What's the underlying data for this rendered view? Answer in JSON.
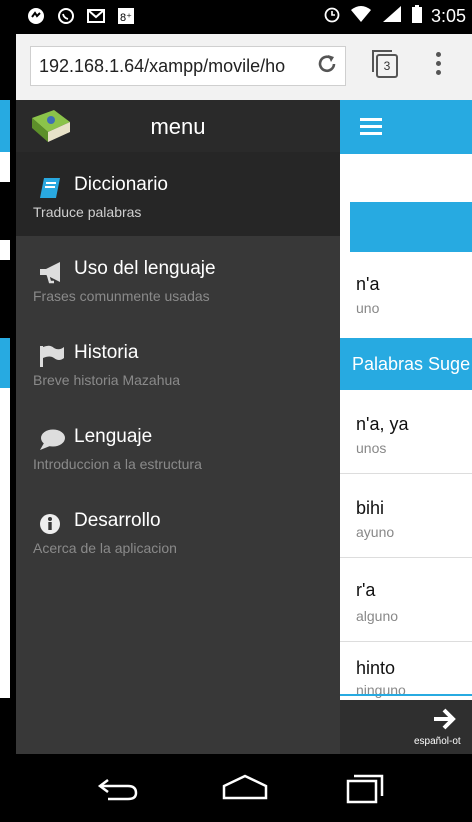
{
  "status_bar": {
    "time": "3:05",
    "left_icons": [
      "hangouts-icon",
      "whatsapp-icon",
      "gmail-icon",
      "googleplus-icon"
    ],
    "right_icons": [
      "alarm-icon",
      "wifi-icon",
      "signal-icon",
      "battery-icon"
    ]
  },
  "browser": {
    "url": "192.168.1.64/xampp/movile/ho",
    "tab_count": "3"
  },
  "drawer": {
    "title": "menu",
    "items": [
      {
        "label": "Diccionario",
        "sub": "Traduce palabras",
        "icon": "book-icon",
        "active": true
      },
      {
        "label": "Uso del lenguaje",
        "sub": "Frases comunmente usadas",
        "icon": "megaphone-icon",
        "active": false
      },
      {
        "label": "Historia",
        "sub": "Breve historia Mazahua",
        "icon": "flag-icon",
        "active": false
      },
      {
        "label": "Lenguaje",
        "sub": "Introduccion a la estructura",
        "icon": "speech-bubble-icon",
        "active": false
      },
      {
        "label": "Desarrollo",
        "sub": "Acerca de la aplicacion",
        "icon": "info-icon",
        "active": false
      }
    ]
  },
  "content": {
    "first_word": {
      "word": "n'a",
      "meaning": "uno"
    },
    "suggestions_header": "Palabras Suge",
    "suggestions": [
      {
        "word": "n'a, ya",
        "meaning": "unos"
      },
      {
        "word": "bihi",
        "meaning": "ayuno"
      },
      {
        "word": "r'a",
        "meaning": "alguno"
      },
      {
        "word": "hinto",
        "meaning": "ninguno"
      }
    ],
    "footer_label": "español-ot"
  },
  "colors": {
    "accent": "#27aae1",
    "drawer_bg": "#383838",
    "drawer_active": "#262626"
  }
}
